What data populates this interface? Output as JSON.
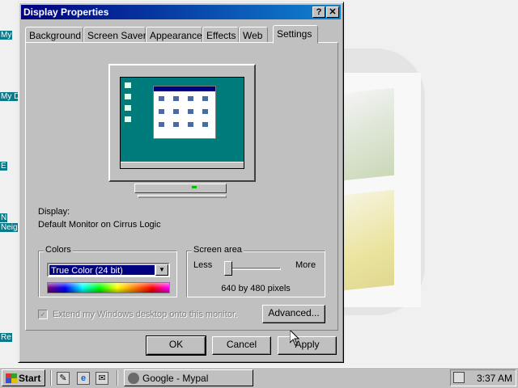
{
  "window": {
    "title": "Display Properties",
    "help_glyph": "?",
    "close_glyph": "✕"
  },
  "desktop_icons": [
    "My",
    "My D",
    "E",
    "N",
    "Neig",
    "Re"
  ],
  "tabs": [
    {
      "label": "Background"
    },
    {
      "label": "Screen Saver"
    },
    {
      "label": "Appearance"
    },
    {
      "label": "Effects"
    },
    {
      "label": "Web"
    },
    {
      "label": "Settings",
      "active": true
    }
  ],
  "settings": {
    "display_label": "Display:",
    "display_value": "Default Monitor on Cirrus Logic",
    "colors": {
      "label": "Colors",
      "selected": "True Color (24 bit)"
    },
    "screen_area": {
      "label": "Screen area",
      "less": "Less",
      "more": "More",
      "value": "640 by 480 pixels",
      "slider_position_fraction": 0.0
    },
    "extend_checkbox": {
      "label": "Extend my Windows desktop onto this monitor.",
      "checked": true,
      "disabled": true
    },
    "advanced_label": "Advanced..."
  },
  "buttons": {
    "ok": "OK",
    "cancel": "Cancel",
    "apply": "Apply"
  },
  "taskbar": {
    "start_label": "Start",
    "task_item": "Google - Mypal",
    "clock": "3:37 AM"
  },
  "colors": {
    "titlebar_start": "#000080",
    "titlebar_end": "#1084d0",
    "face": "#c0c0c0",
    "desktop_teal": "#007b7b"
  }
}
